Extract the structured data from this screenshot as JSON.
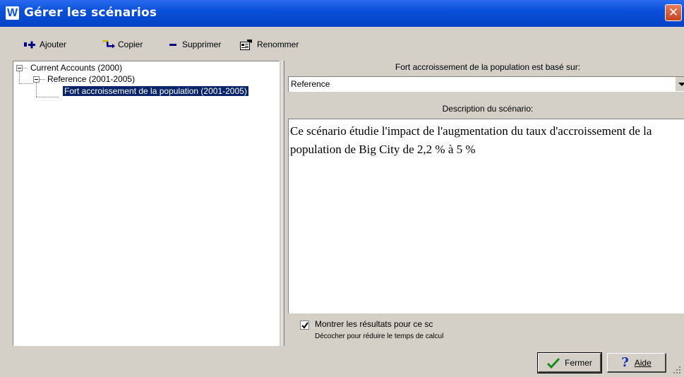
{
  "window": {
    "title": "Gérer les scénarios",
    "app_icon_letter": "W"
  },
  "toolbar": {
    "add_label": "Ajouter",
    "copy_label": "Copier",
    "delete_label": "Supprimer",
    "rename_label": "Renommer"
  },
  "tree": {
    "root": {
      "label": "Current Accounts (2000)"
    },
    "child": {
      "label": "Reference (2001-2005)"
    },
    "grandchild": {
      "label": "Fort accroissement de la population (2001-2005)"
    }
  },
  "based_on": {
    "label": "Fort accroissement de la population est basé sur:",
    "value": "Reference"
  },
  "description": {
    "label": "Description du scénario:",
    "text": "Ce scénario étudie l'impact de l'augmentation du taux d'accroissement de la population de Big City de 2,2 % à 5 %"
  },
  "show_results": {
    "checked": true,
    "label": "Montrer les résultats pour ce sc",
    "hint": "Décocher pour réduire le temps de calcul"
  },
  "buttons": {
    "close_label": "Fermer",
    "help_label": "Aide"
  },
  "colors": {
    "titlebar": "#0a50d8",
    "selection": "#0a246a",
    "dialog_bg": "#d4d0c8"
  }
}
